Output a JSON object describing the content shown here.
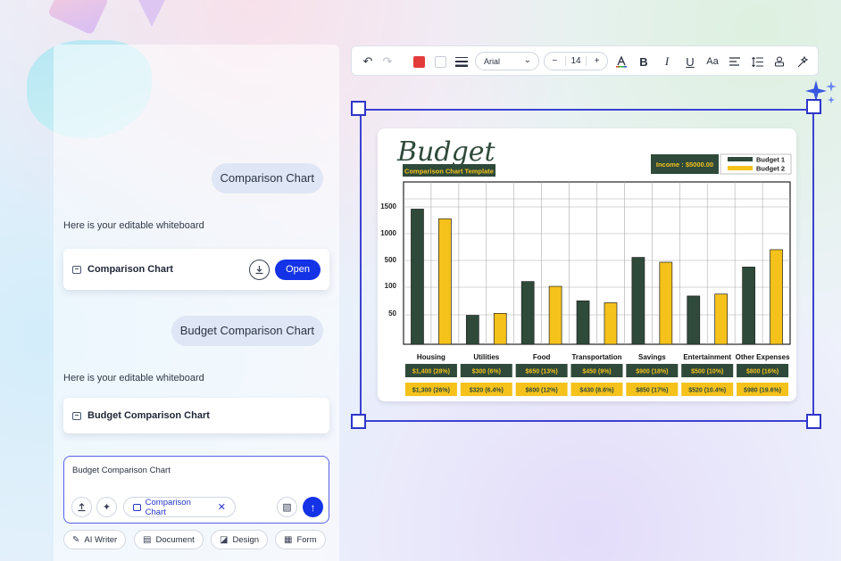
{
  "chat": {
    "messages": [
      {
        "role": "user",
        "text": "Comparison Chart"
      },
      {
        "role": "assistant",
        "text": "Here is your editable whiteboard",
        "card_title": "Comparison Chart",
        "card_button": "Open"
      },
      {
        "role": "user",
        "text": "Budget Comparison Chart"
      },
      {
        "role": "assistant",
        "text": "Here is your editable whiteboard",
        "card_title": "Budget Comparison Chart"
      }
    ],
    "input": {
      "value": "Budget Comparison Chart",
      "chip": "Comparison Chart"
    },
    "tools": [
      "AI Writer",
      "Document",
      "Design",
      "Form"
    ]
  },
  "toolbar": {
    "font": "Arial",
    "font_size": "14",
    "minus": "−",
    "plus": "+",
    "fill_color": "#e23b3b",
    "stroke_color": "#ffffff",
    "icons": [
      "undo-icon",
      "redo-icon",
      "fill-color",
      "stroke-color",
      "line-weight-icon",
      "font-select",
      "font-size",
      "text-color-icon",
      "bold-icon",
      "italic-icon",
      "underline-icon",
      "case-icon",
      "align-icon",
      "line-spacing-icon",
      "stamp-icon",
      "magic-icon"
    ]
  },
  "chart_data": {
    "type": "bar",
    "title": "Budget",
    "subtitle": "Comparison Chart Template",
    "income_label": "Income : $5000.00",
    "categories": [
      "Housing",
      "Utilities",
      "Food",
      "Transportation",
      "Savings",
      "Entertainment",
      "Other Expenses"
    ],
    "y_ticks": [
      "50",
      "100",
      "500",
      "1000",
      "1500"
    ],
    "series": [
      {
        "name": "Budget 1",
        "color": "#2f4a3a",
        "values": [
          1400,
          300,
          650,
          450,
          900,
          500,
          800
        ],
        "labels": [
          "$1,400 (28%)",
          "$300 (6%)",
          "$650 (13%)",
          "$450 (9%)",
          "$900 (18%)",
          "$500 (10%)",
          "$800 (16%)"
        ]
      },
      {
        "name": "Budget 2",
        "color": "#f5c21b",
        "values": [
          1300,
          320,
          600,
          430,
          850,
          520,
          980
        ],
        "labels": [
          "$1,300 (26%)",
          "$320 (6.4%)",
          "$600 (12%)",
          "$430 (8.6%)",
          "$850 (17%)",
          "$520 (10.4%)",
          "$980 (19.6%)"
        ]
      }
    ],
    "grid": true,
    "legend": "top-right"
  }
}
